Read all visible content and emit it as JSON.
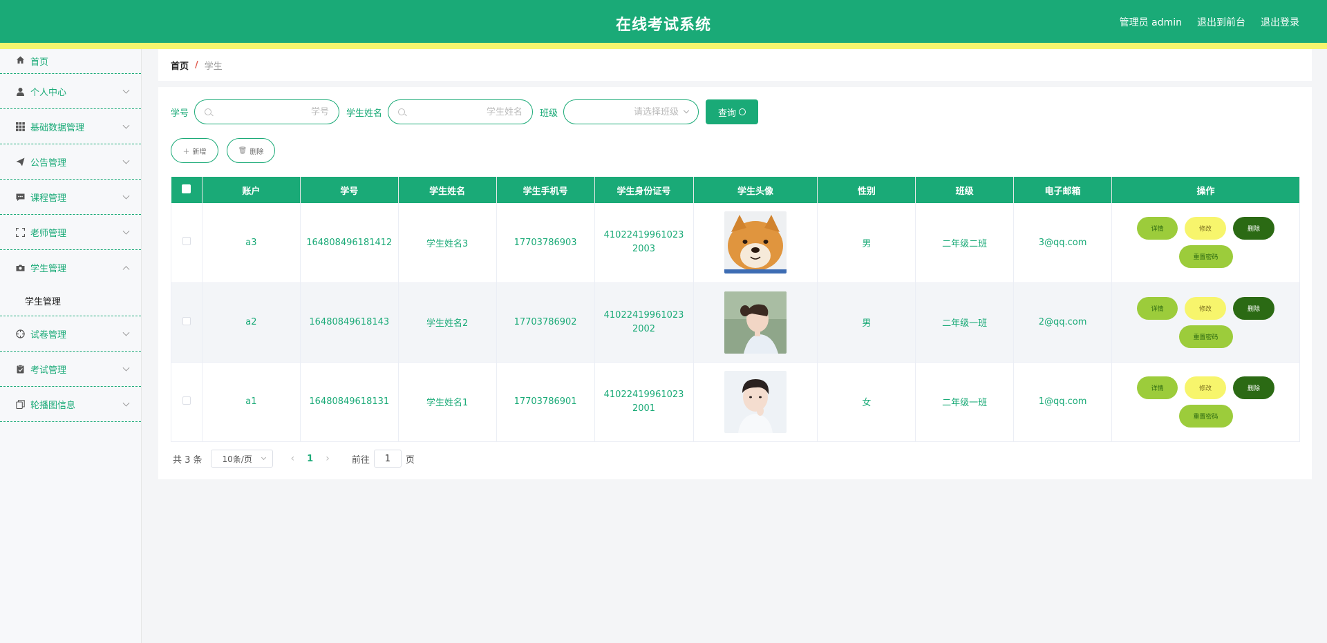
{
  "header": {
    "title": "在线考试系统",
    "user_label": "管理员 admin",
    "back_front": "退出到前台",
    "logout": "退出登录"
  },
  "sidebar": {
    "items": [
      {
        "label": "首页",
        "icon": "home-icon"
      },
      {
        "label": "个人中心",
        "icon": "user-icon"
      },
      {
        "label": "基础数据管理",
        "icon": "grid-icon"
      },
      {
        "label": "公告管理",
        "icon": "send-icon"
      },
      {
        "label": "课程管理",
        "icon": "chat-icon"
      },
      {
        "label": "老师管理",
        "icon": "fullscreen-icon"
      },
      {
        "label": "学生管理",
        "icon": "camera-icon",
        "expanded": true,
        "sub": [
          "学生管理"
        ]
      },
      {
        "label": "试卷管理",
        "icon": "compass-icon"
      },
      {
        "label": "考试管理",
        "icon": "clipboard-icon"
      },
      {
        "label": "轮播图信息",
        "icon": "copy-icon"
      }
    ]
  },
  "breadcrumb": {
    "home": "首页",
    "sep": "/",
    "current": "学生"
  },
  "search": {
    "student_no_label": "学号",
    "student_no_placeholder": "学号",
    "student_name_label": "学生姓名",
    "student_name_placeholder": "学生姓名",
    "class_label": "班级",
    "class_placeholder": "请选择班级",
    "query_label": "查询"
  },
  "actions": {
    "add": "新增",
    "delete": "删除"
  },
  "table": {
    "headers": [
      "账户",
      "学号",
      "学生姓名",
      "学生手机号",
      "学生身份证号",
      "学生头像",
      "性别",
      "班级",
      "电子邮箱",
      "操作"
    ],
    "rows": [
      {
        "account": "a3",
        "student_no": "164808496181412",
        "name": "学生姓名3",
        "phone": "17703786903",
        "id_card": "410224199610232003",
        "avatar": "shiba-dog-photo",
        "gender": "男",
        "class": "二年级二班",
        "email": "3@qq.com"
      },
      {
        "account": "a2",
        "student_no": "16480849618143",
        "name": "学生姓名2",
        "phone": "17703786902",
        "id_card": "410224199610232002",
        "avatar": "girl-profile-photo",
        "gender": "男",
        "class": "二年级一班",
        "email": "2@qq.com"
      },
      {
        "account": "a1",
        "student_no": "16480849618131",
        "name": "学生姓名1",
        "phone": "17703786901",
        "id_card": "410224199610232001",
        "avatar": "boy-portrait-photo",
        "gender": "女",
        "class": "二年级一班",
        "email": "1@qq.com"
      }
    ],
    "op_labels": {
      "detail": "详情",
      "edit": "修改",
      "delete": "删除",
      "reset": "重置密码"
    }
  },
  "pagination": {
    "total": "共 3 条",
    "page_size": "10条/页",
    "current_page": "1",
    "goto_label": "前往",
    "goto_value": "1",
    "page_suffix": "页"
  },
  "colors": {
    "primary": "#1aaa77",
    "stripe": "#f5f56e",
    "detail": "#9ccc3b",
    "edit": "#f7f56c",
    "delete": "#2b6a14"
  }
}
